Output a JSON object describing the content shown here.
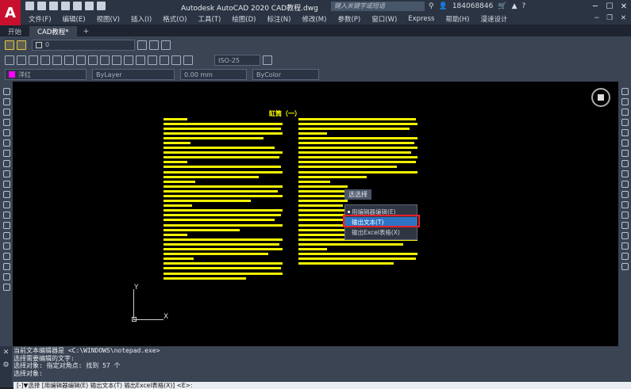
{
  "title_bar": {
    "logo": "A",
    "app_title": "Autodesk AutoCAD 2020    CAD教程.dwg",
    "search_placeholder": "键入关键字或短语",
    "username": "184068846",
    "icons": [
      "binoculars-icon",
      "user-icon",
      "cart-icon",
      "a360-icon",
      "help-icon"
    ]
  },
  "menu": {
    "items": [
      "文件(F)",
      "编辑(E)",
      "视图(V)",
      "插入(I)",
      "格式(O)",
      "工具(T)",
      "绘图(D)",
      "标注(N)",
      "修改(M)",
      "参数(P)",
      "窗口(W)",
      "Express",
      "帮助(H)",
      "漫速设计"
    ]
  },
  "tabs": [
    {
      "label": "开始"
    },
    {
      "label": "CAD教程*"
    }
  ],
  "toolbar": {
    "layer_value": "0",
    "dimstyle_value": "ISO-25",
    "color_value": "洋红",
    "linetype_value": "ByLayer",
    "lineweight_value": "0.00 mm",
    "plotstyle_value": "ByColor"
  },
  "drawing": {
    "doc_title": "缸筒（一）",
    "ucs_x": "X",
    "ucs_y": "Y"
  },
  "dynamic_prompt": {
    "label": "选选择",
    "options": [
      {
        "label": "用编辑器编辑(E)",
        "selected": true
      },
      {
        "label": "输出文本(T)",
        "highlighted": true
      },
      {
        "label": "输出Excel表格(X)"
      }
    ]
  },
  "command": {
    "history": [
      "当前文本编辑器是 <C:\\WINDOWS\\notepad.exe>",
      "选择需要编辑的文字:",
      "选择对象: 指定对角点: 找到 57 个",
      "选择对象:"
    ],
    "prompt_prefix": "[-]▼选择 [用编辑器编辑(E) 输出文本(T) 输出Excel表格(X)] <E>:"
  },
  "colors": {
    "accent": "#2d74c4",
    "highlight_box": "#e8202a",
    "drawing_text": "#ffff00",
    "canvas_bg": "#000000"
  }
}
